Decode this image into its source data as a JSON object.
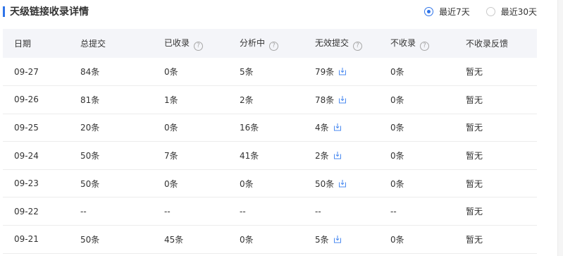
{
  "header": {
    "title": "天级链接收录详情",
    "accent_color": "#2f74e9",
    "range_options": [
      {
        "label": "最近7天",
        "selected": true
      },
      {
        "label": "最近30天",
        "selected": false
      }
    ]
  },
  "table": {
    "columns": [
      "日期",
      "总提交",
      "已收录",
      "分析中",
      "无效提交",
      "不收录",
      "不收录反馈"
    ],
    "help_icon": "?",
    "rows": [
      [
        "09-27",
        "84条",
        "0条",
        "5条",
        "79条",
        "0条",
        "暂无"
      ],
      [
        "09-26",
        "81条",
        "1条",
        "2条",
        "78条",
        "0条",
        "暂无"
      ],
      [
        "09-25",
        "20条",
        "0条",
        "16条",
        "4条",
        "0条",
        "暂无"
      ],
      [
        "09-24",
        "50条",
        "7条",
        "41条",
        "2条",
        "0条",
        "暂无"
      ],
      [
        "09-23",
        "50条",
        "0条",
        "0条",
        "50条",
        "0条",
        "暂无"
      ],
      [
        "09-22",
        "--",
        "--",
        "--",
        "--",
        "--",
        "暂无"
      ],
      [
        "09-21",
        "50条",
        "45条",
        "0条",
        "5条",
        "0条",
        "暂无"
      ]
    ]
  }
}
